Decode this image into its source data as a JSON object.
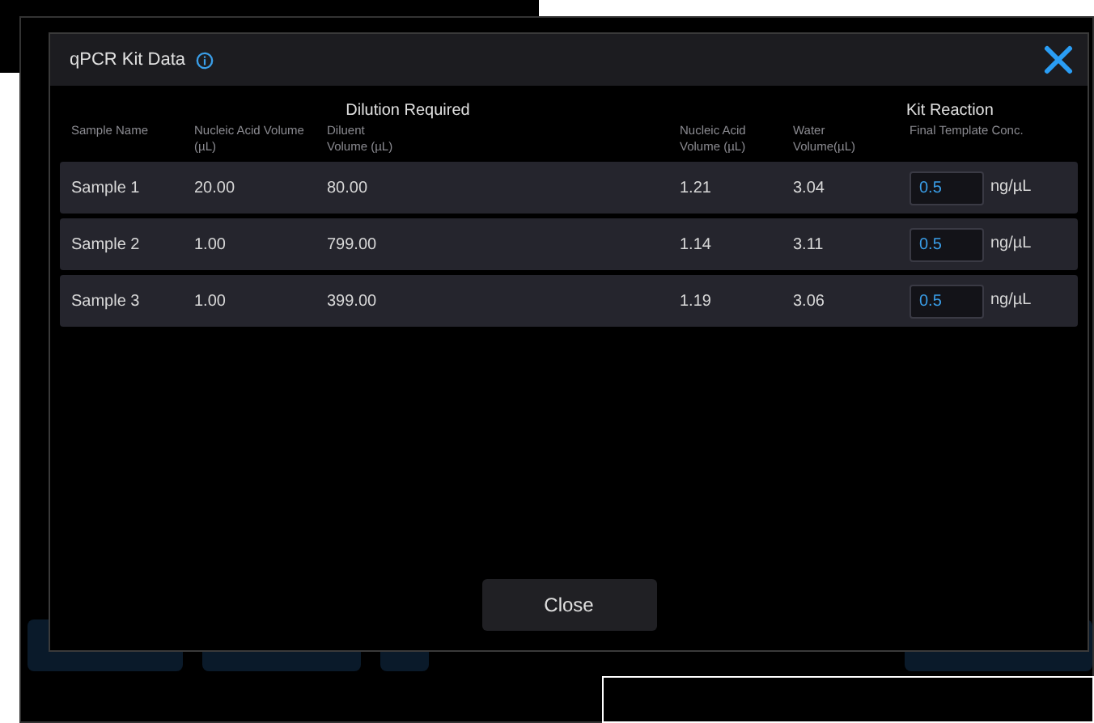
{
  "dialog": {
    "title": "qPCR Kit Data",
    "group_headers": [
      "Dilution Required",
      "Kit Reaction"
    ],
    "columns": [
      "Sample Name",
      "Nucleic Acid Volume (µL)",
      "Diluent Volume (µL)",
      "Nucleic Acid Volume (µL)",
      "Water Volume(µL)",
      "Final Template Conc."
    ],
    "rows": [
      {
        "cells": [
          "Sample 1",
          "20.00",
          "80.00",
          "1.21",
          "3.04"
        ],
        "conc": "0.5",
        "unit": "ng/µL"
      },
      {
        "cells": [
          "Sample 2",
          "1.00",
          "799.00",
          "1.14",
          "3.11"
        ],
        "conc": "0.5",
        "unit": "ng/µL"
      },
      {
        "cells": [
          "Sample 3",
          "1.00",
          "399.00",
          "1.19",
          "3.06"
        ],
        "conc": "0.5",
        "unit": "ng/µL"
      }
    ],
    "close_button": "Close"
  }
}
